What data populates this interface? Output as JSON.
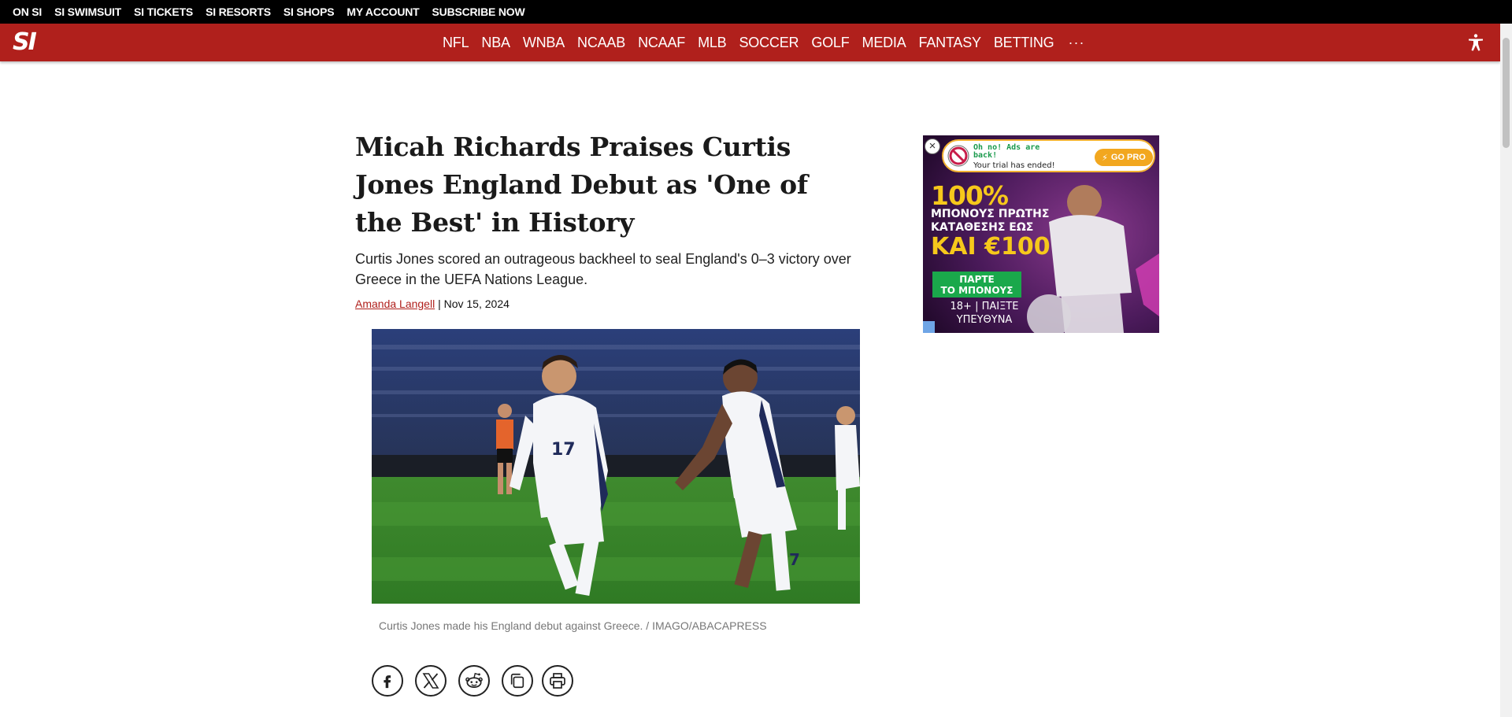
{
  "topbar": {
    "links": [
      "ON SI",
      "SI SWIMSUIT",
      "SI TICKETS",
      "SI RESORTS",
      "SI SHOPS",
      "MY ACCOUNT",
      "SUBSCRIBE NOW"
    ]
  },
  "navbar": {
    "logo": "SI",
    "items": [
      "NFL",
      "NBA",
      "WNBA",
      "NCAAB",
      "NCAAF",
      "MLB",
      "SOCCER",
      "GOLF",
      "MEDIA",
      "FANTASY",
      "BETTING"
    ],
    "more": "···",
    "accessibility_icon": "accessibility-icon"
  },
  "article": {
    "headline": "Micah Richards Praises Curtis Jones England Debut as 'One of the Best' in History",
    "dek": "Curtis Jones scored an outrageous backheel to seal England's 0–3 victory over Greece in the UEFA Nations League.",
    "author": "Amanda Langell",
    "separator": "|",
    "date": "Nov 15, 2024",
    "caption": "Curtis Jones made his England debut against Greece. / IMAGO/ABACAPRESS",
    "share_icons": [
      "facebook-icon",
      "x-icon",
      "reddit-icon",
      "copy-icon",
      "print-icon"
    ]
  },
  "ad": {
    "close": "×",
    "notice_title": "Oh no! Ads are back!",
    "notice_sub": "Your trial has ended!",
    "go_pro": "GO PRO",
    "big": "100%",
    "line1": "ΜΠΟΝΟΥΣ ΠΡΩΤΗΣ",
    "line2": "ΚΑΤΑΘΕΣΗΣ ΕΩΣ",
    "amount": "ΚΑΙ €100",
    "cta_line1": "ΠΑΡΤΕ",
    "cta_line2": "ΤΟ ΜΠΟΝΟΥΣ",
    "age_line1": "18+ | ΠΑΙΞΤΕ",
    "age_line2": "ΥΠΕΥΘΥΝΑ"
  },
  "colors": {
    "brand_red": "#b0201c",
    "topbar": "#000000",
    "ad_gold": "#f6c81b",
    "ad_green": "#1aa84b"
  }
}
